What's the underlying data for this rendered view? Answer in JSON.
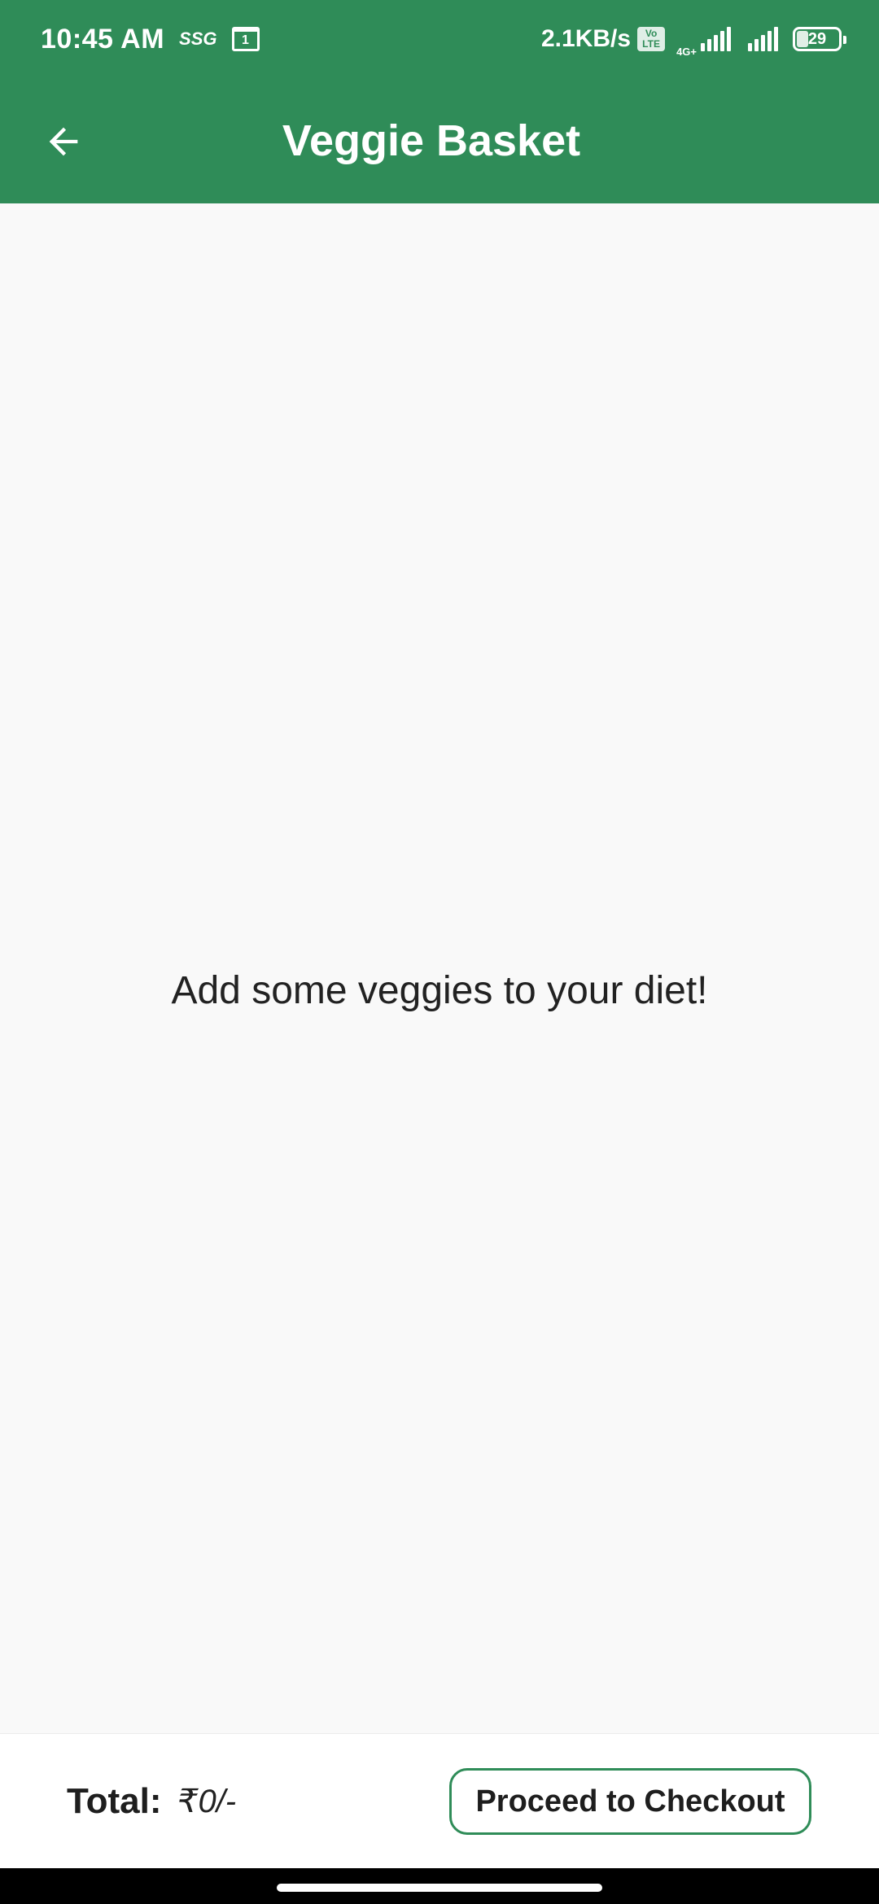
{
  "status_bar": {
    "time": "10:45 AM",
    "carrier_tag": "SSG",
    "calendar_day": "1",
    "net_speed": "2.1KB/s",
    "volte_top": "Vo",
    "volte_bottom": "LTE",
    "network": "4G+",
    "battery": "29"
  },
  "app_bar": {
    "title": "Veggie Basket",
    "back_icon": "arrow-left-icon"
  },
  "main": {
    "empty_message": "Add some veggies to your diet!"
  },
  "footer": {
    "total_label": "Total:",
    "total_value": "₹0/-",
    "checkout_label": "Proceed to Checkout"
  },
  "colors": {
    "primary": "#2f8c58",
    "background": "#f9f9f9",
    "text": "#222222"
  }
}
